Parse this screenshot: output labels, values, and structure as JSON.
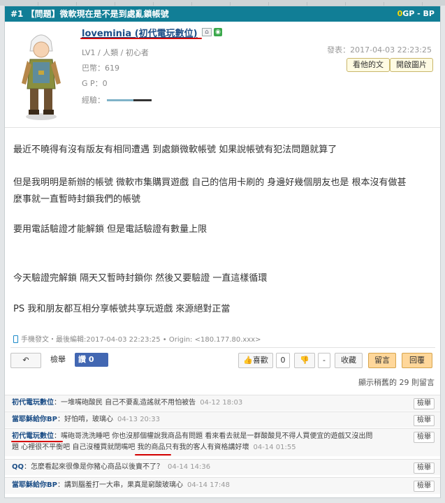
{
  "post": {
    "title": "#1 【問題】微軟現在是不是到處亂鎖帳號",
    "gp_count": "0",
    "gp_label": "GP",
    "bp_label": "- BP",
    "author": {
      "name": "loveminia (初代電玩數位)",
      "level": "LV1 / 人類 / 初心者",
      "coins": "巴幣：619",
      "gp": "G P：0",
      "exp_label": "經驗：",
      "exp_fraction": 0.6
    },
    "posted_at": "發表：2017-04-03 22:23:25",
    "btn_view_posts": "看他的文",
    "btn_open_image": "開啟圖片",
    "content": [
      "最近不曉得有沒有版友有相同遭遇 到處鎖微軟帳號 如果說帳號有犯法問題就算了",
      "但是我明明是新辦的帳號 微軟市集購買遊戲 自己的信用卡刷的 身邊好幾個朋友也是 根本沒有做甚",
      "麼事就一直暫時封鎖我們的帳號",
      "要用電話驗證才能解鎖 但是電話驗證有數量上限",
      "今天驗證完解鎖 隔天又暫時封鎖你 然後又要驗證 一直這樣循環",
      "PS 我和朋友都互相分享帳號共享玩遊戲 來源絕對正當"
    ],
    "footer_meta": "手機發文・最後編輯:2017-04-03 22:23:25 • Origin: <180.177.80.xxx>"
  },
  "actions": {
    "report": "檢舉",
    "fb_like": "讚 0",
    "like": "喜歡",
    "like_count": "0",
    "dislike_sep": "-",
    "favorite": "收藏",
    "comment": "留言",
    "reply": "回覆"
  },
  "comments_header": "顯示稍舊的 29 則留言",
  "comments": [
    {
      "who": "初代電玩數位",
      "text": "：一堆嘴砲酸民 自己不要亂造謠就不用怕被告",
      "ts": "04-12 18:03"
    },
    {
      "who": "當耶穌給你BP",
      "text": "：好怕唷，玻璃心",
      "ts": "04-13 20:33"
    },
    {
      "who": "初代電玩數位",
      "text": "：嘴砲哥洗洗睡吧 你也沒那個權說我商品有問題 看來看去就是一群酸酸見不得人買便宜的遊戲又沒出問",
      "text2": "題 心裡很不平衡吧 自己沒種買就閉嘴吧 我的商品只有我的客人有資格講好壞",
      "ts": "04-14 01:55"
    },
    {
      "who": "QQ",
      "text": "：怎麼看起來很像是你豬心商品以後賣不了？",
      "ts": "04-14 14:36"
    },
    {
      "who": "當耶穌給你BP",
      "text": "：講到腦羞打一大串，果真是窮酸玻璃心",
      "ts": "04-14 17:48"
    }
  ],
  "comment_report": "檢舉"
}
